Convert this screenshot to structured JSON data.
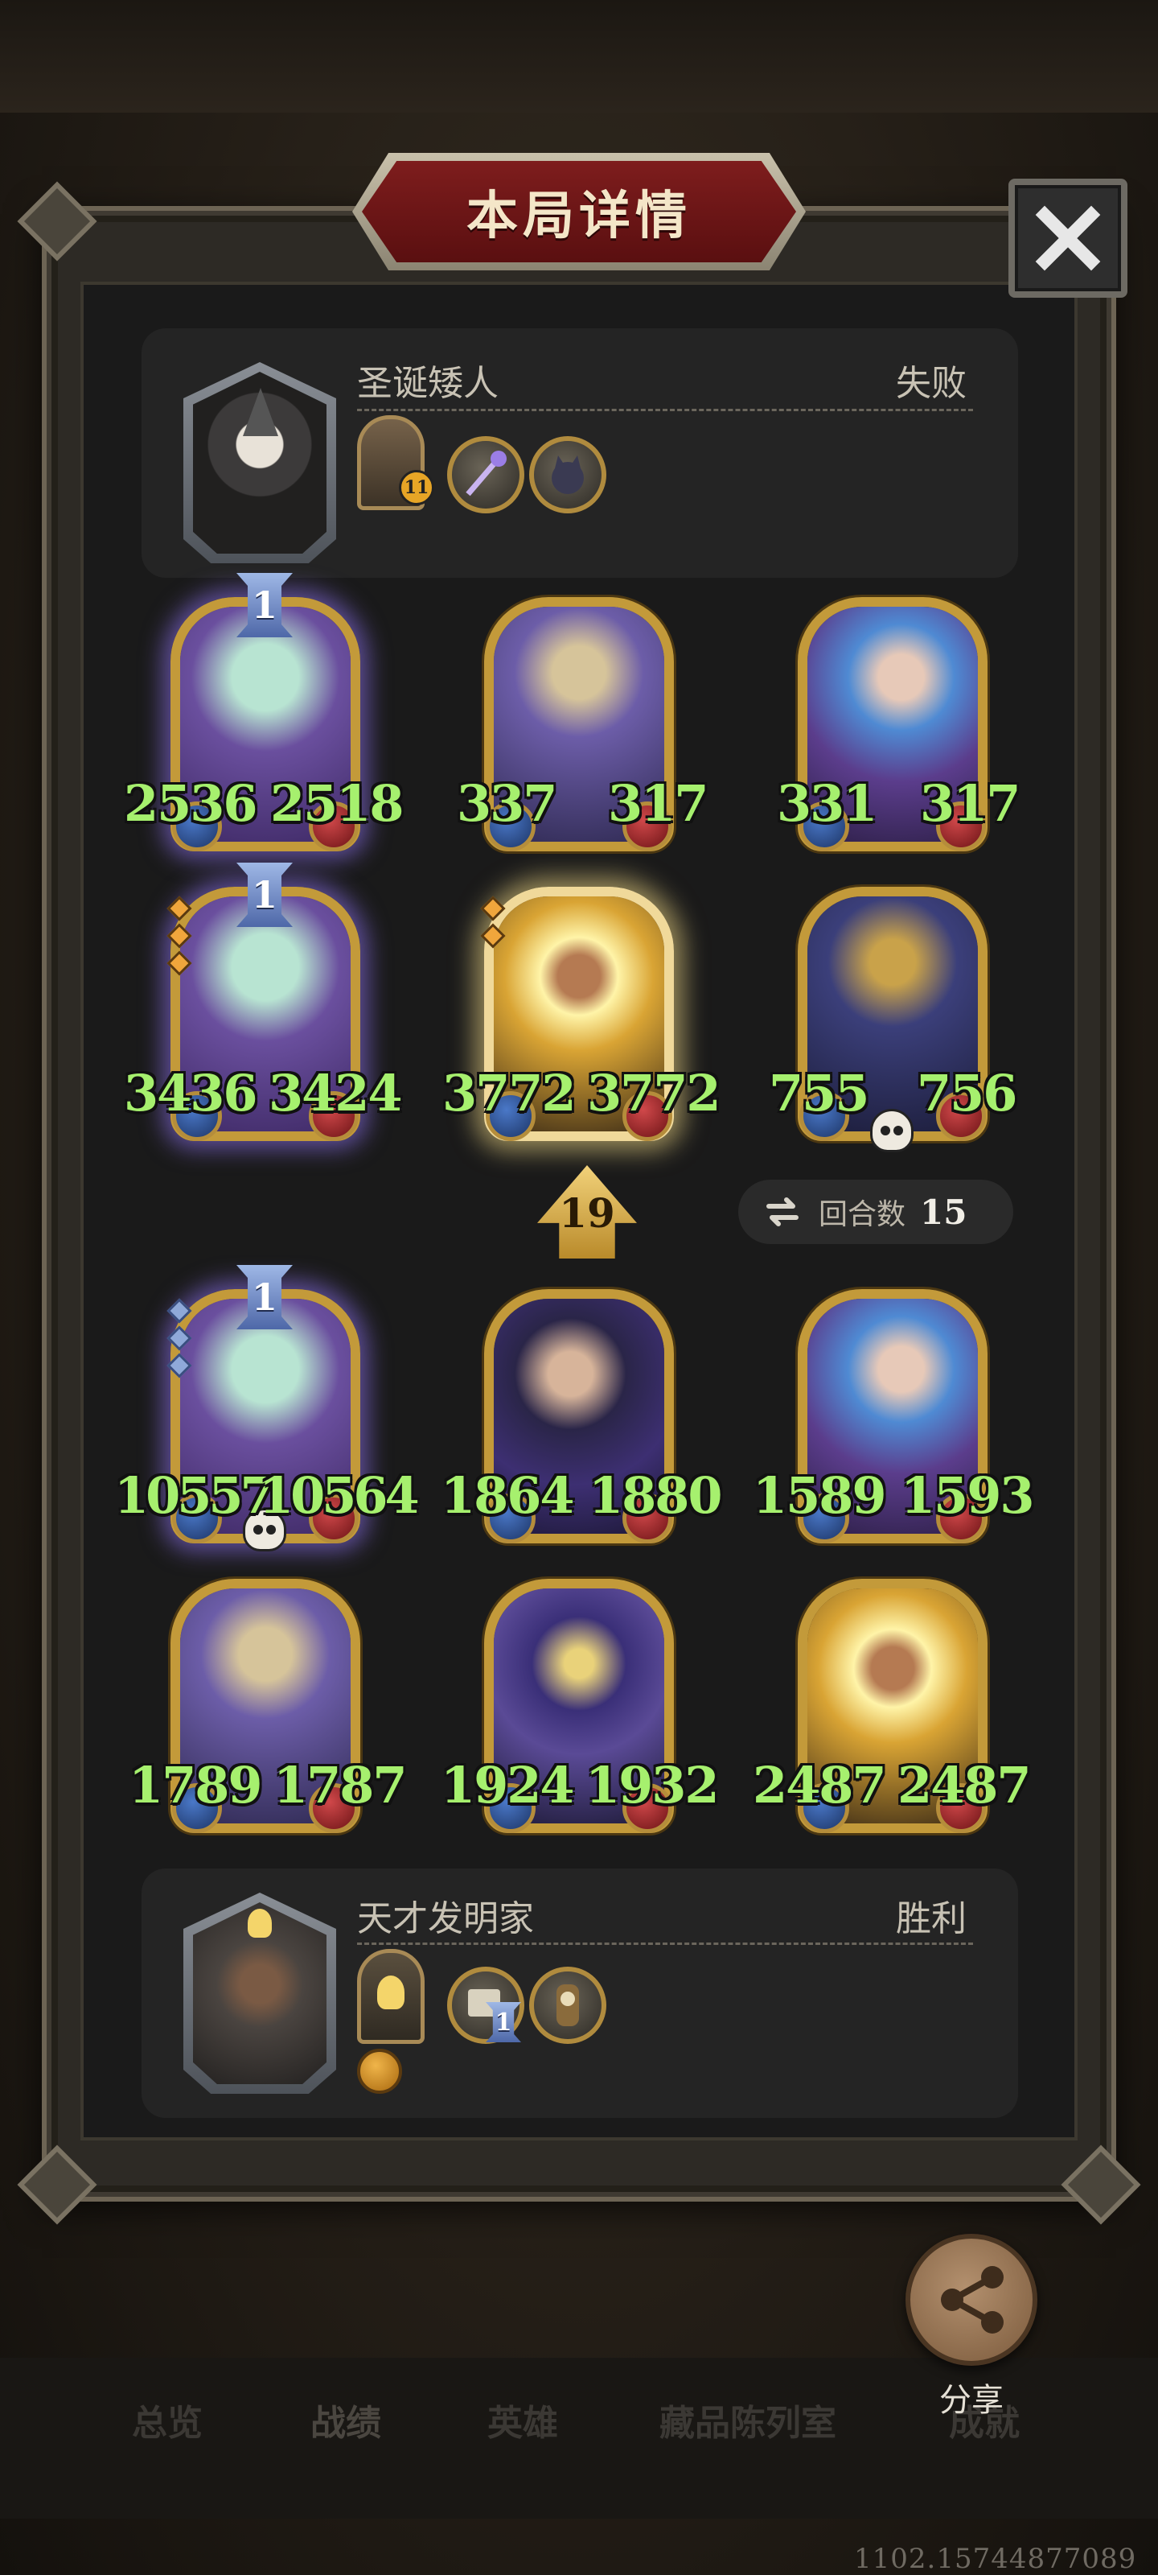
{
  "title": "本局详情",
  "opponent": {
    "name": "圣诞矮人",
    "result": "失败",
    "item_badge": "11"
  },
  "player": {
    "name": "天才发明家",
    "result": "胜利",
    "item_badge": "1"
  },
  "tier": "19",
  "round_label": "回合数",
  "round_value": "15",
  "opponent_board": [
    {
      "atk": "2536",
      "hp": "2518",
      "level": "1"
    },
    {
      "atk": "337",
      "hp": "317"
    },
    {
      "atk": "331",
      "hp": "317"
    },
    {
      "atk": "3436",
      "hp": "3424",
      "level": "1"
    },
    {
      "atk": "3772",
      "hp": "3772"
    },
    {
      "atk": "755",
      "hp": "756"
    }
  ],
  "player_board": [
    {
      "atk": "10557",
      "hp": "10564",
      "level": "1"
    },
    {
      "atk": "1864",
      "hp": "1880"
    },
    {
      "atk": "1589",
      "hp": "1593"
    },
    {
      "atk": "1789",
      "hp": "1787"
    },
    {
      "atk": "1924",
      "hp": "1932"
    },
    {
      "atk": "2487",
      "hp": "2487"
    }
  ],
  "share_label": "分享",
  "tabs": [
    "总览",
    "战绩",
    "英雄",
    "藏品陈列室",
    "成就"
  ],
  "build_id": "1102.15744877089",
  "colors": {
    "stat_text": "#a6f06e",
    "banner": "#7e1d1d",
    "card_border": "#c39a3a"
  }
}
